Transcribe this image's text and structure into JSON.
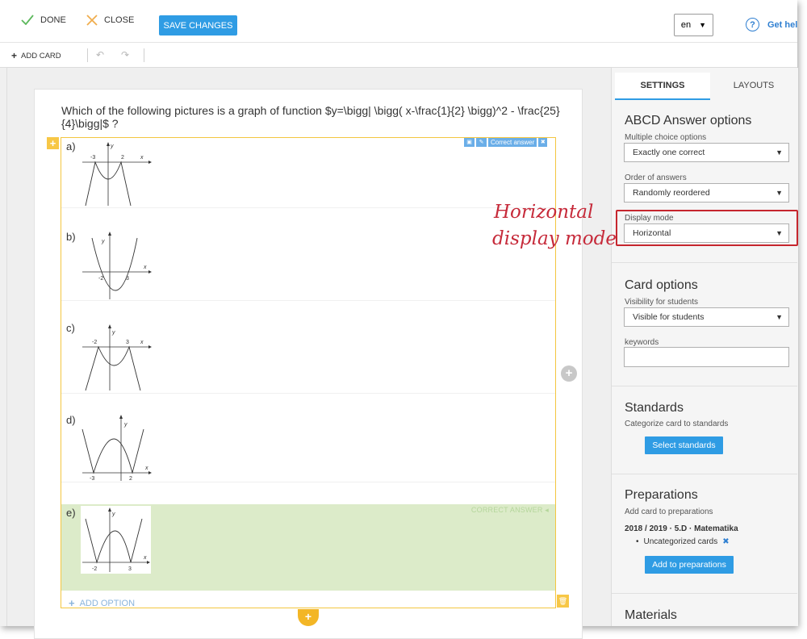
{
  "topbar": {
    "done_label": "DONE",
    "close_label": "CLOSE",
    "save_label": "SAVE CHANGES",
    "language": "en",
    "help_label": "Get hel",
    "colors": {
      "done_icon": "#5cb85c",
      "close_icon": "#f0ad4e",
      "save_bg": "#2f9ce4"
    }
  },
  "toolbar": {
    "add_card_label": "ADD CARD",
    "undo_icon": "undo-icon",
    "redo_icon": "redo-icon"
  },
  "card": {
    "question": "Which of the following pictures is a graph of function $y=\\bigg| \\bigg( x-\\frac{1}{2} \\bigg)^2 - \\frac{25}{4}\\bigg|$ ?",
    "tools": {
      "correct_answer_tag": "Correct answer"
    },
    "options": [
      {
        "letter": "a)",
        "ticks": [
          "-3",
          "2"
        ],
        "axis_x": "x",
        "axis_y": "y",
        "correct": false
      },
      {
        "letter": "b)",
        "ticks": [
          "-2",
          "3"
        ],
        "axis_x": "x",
        "axis_y": "y",
        "correct": false
      },
      {
        "letter": "c)",
        "ticks": [
          "-2",
          "3"
        ],
        "axis_x": "x",
        "axis_y": "y",
        "correct": false
      },
      {
        "letter": "d)",
        "ticks": [
          "-3",
          "2"
        ],
        "axis_x": "x",
        "axis_y": "y",
        "correct": false
      },
      {
        "letter": "e)",
        "ticks": [
          "-2",
          "3"
        ],
        "axis_x": "x",
        "axis_y": "y",
        "correct": true
      }
    ],
    "correct_answer_label": "CORRECT ANSWER",
    "add_option_label": "ADD OPTION"
  },
  "sidebar": {
    "tabs": [
      {
        "label": "SETTINGS",
        "active": true
      },
      {
        "label": "LAYOUTS",
        "active": false
      }
    ],
    "abcd": {
      "title": "ABCD Answer options",
      "multiple_label": "Multiple choice options",
      "multiple_value": "Exactly one correct",
      "order_label": "Order of answers",
      "order_value": "Randomly reordered",
      "display_label": "Display mode",
      "display_value": "Horizontal"
    },
    "card_options": {
      "title": "Card options",
      "visibility_label": "Visibility for students",
      "visibility_value": "Visible for students",
      "keywords_label": "keywords",
      "keywords_value": ""
    },
    "standards": {
      "title": "Standards",
      "desc": "Categorize card to standards",
      "button": "Select standards"
    },
    "preparations": {
      "title": "Preparations",
      "desc": "Add card to preparations",
      "year": "2018 / 2019 · 5.D · Matematika",
      "item": "Uncategorized cards",
      "button": "Add to preparations"
    },
    "materials": {
      "title": "Materials"
    }
  },
  "annotation": {
    "line1": "Horizontal",
    "line2": "display mode",
    "color": "#c62a3a"
  }
}
